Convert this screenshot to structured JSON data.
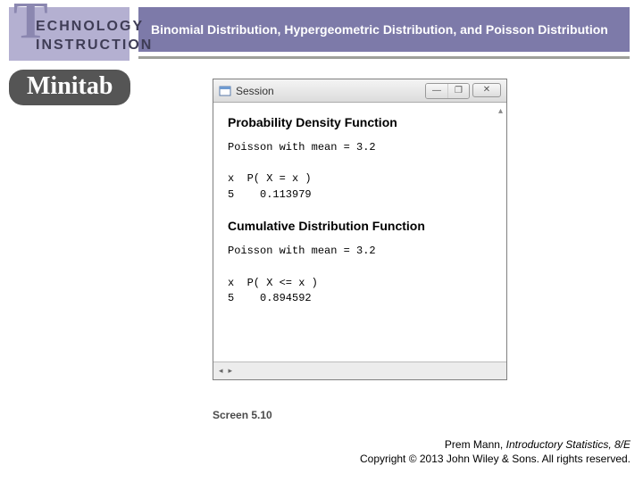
{
  "header": {
    "bigT": "T",
    "tech1": "ECHNOLOGY",
    "tech2": "INSTRUCTION",
    "title": "Binomial Distribution, Hypergeometric Distribution, and Poisson Distribution"
  },
  "brand": {
    "name": "Minitab"
  },
  "session": {
    "title": "Session",
    "pdf": {
      "heading": "Probability Density Function",
      "line1": "Poisson with mean = 3.2",
      "table": "x  P( X = x )\n5    0.113979"
    },
    "cdf": {
      "heading": "Cumulative Distribution Function",
      "line1": "Poisson with mean = 3.2",
      "table": "x  P( X <= x )\n5    0.894592"
    }
  },
  "caption": "Screen 5.10",
  "credit": {
    "line1a": "Prem Mann, ",
    "line1b": "Introductory Statistics, 8/E",
    "line2": "Copyright © 2013 John Wiley & Sons. All rights reserved."
  }
}
